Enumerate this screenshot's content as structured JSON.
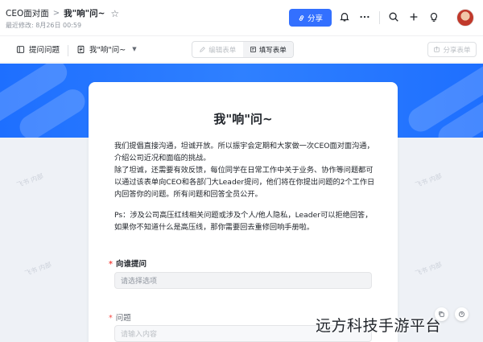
{
  "header": {
    "breadcrumb_root": "CEO面对面",
    "breadcrumb_separator": ">",
    "breadcrumb_current": "我\"响\"问~",
    "last_modified": "最近修改: 8月26日 00:59",
    "share_label": "分享"
  },
  "icons": {
    "star": "star-icon",
    "share": "link-icon",
    "notifications": "bell-icon",
    "more": "more-icon",
    "search": "search-icon",
    "add": "plus-icon",
    "help": "lightbulb-icon",
    "avatar": "avatar"
  },
  "toolbar": {
    "questions_label": "提问问题",
    "view_label": "我\"响\"问~",
    "edit_form_label": "编辑表单",
    "fill_form_label": "填写表单",
    "share_form_label": "分享表单"
  },
  "form": {
    "title": "我\"响\"问~",
    "paragraphs": [
      "我们提倡直接沟通，坦诚开放。所以振宇会定期和大家做一次CEO面对面沟通，介绍公司近况和面临的挑战。",
      "除了坦诚，还需要有效反馈，每位同学在日常工作中关于业务、协作等问题都可以通过该表单向CEO和各部门大Leader提问，他们将在你提出问题的2个工作日内回答你的问题。所有问题和回答全员公开。",
      "Ps：涉及公司高压红线相关问题或涉及个人/他人隐私，Leader可以拒绝回答，如果你不知道什么是高压线，那你需要回去重修回响手册啦。"
    ],
    "fields": [
      {
        "label": "向谁提问",
        "required": true,
        "placeholder": "请选择选项"
      },
      {
        "label": "问题",
        "required": true,
        "placeholder": "请输入内容"
      }
    ]
  },
  "canvas": {
    "watermark_text": "飞书 内部"
  },
  "overlay": {
    "corner_watermark": "远方科技手游平台"
  },
  "colors": {
    "accent": "#3370ff",
    "banner": "#1e6fff",
    "required": "#f54a45"
  }
}
